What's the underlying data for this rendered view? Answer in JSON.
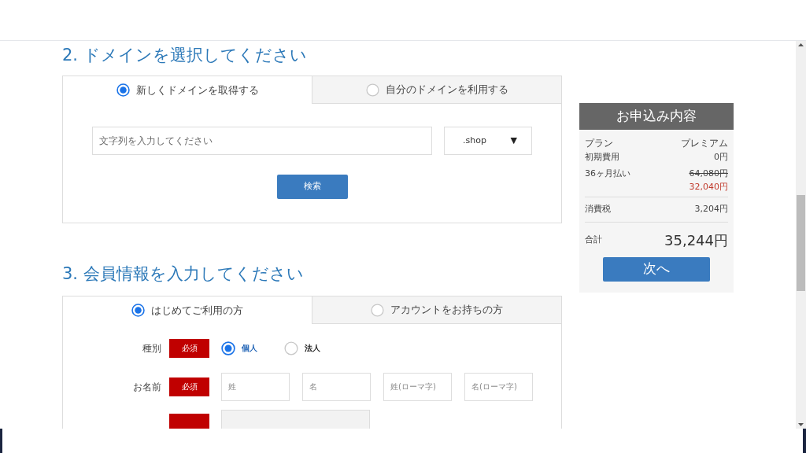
{
  "domain_section": {
    "heading": "2. ドメインを選択してください",
    "tabs": [
      {
        "label": "新しくドメインを取得する",
        "selected": true
      },
      {
        "label": "自分のドメインを利用する",
        "selected": false
      }
    ],
    "search_field": {
      "placeholder": "文字列を入力してください"
    },
    "tld_select": {
      "value": ".shop",
      "caret": "▼"
    },
    "search_button": "検索"
  },
  "member_section": {
    "heading": "3. 会員情報を入力してください",
    "tabs": [
      {
        "label": "はじめてご利用の方",
        "selected": true
      },
      {
        "label": "アカウントをお持ちの方",
        "selected": false
      }
    ],
    "rows": [
      {
        "label": "種別",
        "badge": "必須",
        "kind": "radio",
        "options": [
          {
            "label": "個人",
            "selected": true
          },
          {
            "label": "法人",
            "selected": false
          }
        ]
      },
      {
        "label": "お名前",
        "badge": "必須",
        "kind": "inputs",
        "fields": [
          {
            "placeholder": "姓"
          },
          {
            "placeholder": "名"
          },
          {
            "placeholder": "姓(ローマ字)"
          },
          {
            "placeholder": "名(ローマ字)"
          }
        ]
      },
      {
        "kind": "select"
      }
    ]
  },
  "summary": {
    "title": "お申込み内容",
    "lines": [
      {
        "kind": "plain",
        "label": "プラン",
        "value": "プレミアム"
      },
      {
        "kind": "plain",
        "label": "初期費用",
        "value": "0円"
      },
      {
        "kind": "discount",
        "label": "36ヶ月払い",
        "original": "64,080円",
        "value": "32,040円"
      },
      {
        "kind": "divided",
        "label": "消費税",
        "value": "3,204円"
      },
      {
        "kind": "total",
        "label": "合計",
        "value": "35,244円"
      }
    ],
    "next_button": "次へ"
  }
}
